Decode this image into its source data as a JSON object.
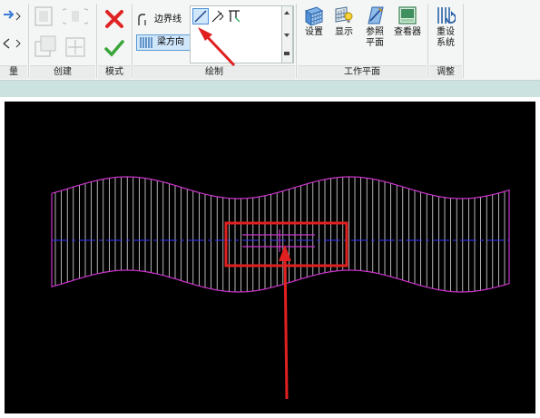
{
  "ribbon": {
    "panels": [
      {
        "label": "量"
      },
      {
        "label": "创建"
      },
      {
        "label": "模式"
      },
      {
        "label": "绘制"
      },
      {
        "label": "工作平面"
      },
      {
        "label": "调整"
      }
    ],
    "draw": {
      "boundary_line": "边界线",
      "span_direction": "梁方向"
    },
    "workplane": {
      "set": "设置",
      "show": "显示",
      "ref_plane_l1": "参照",
      "ref_plane_l2": "平面",
      "viewer": "查看器"
    },
    "adjust": {
      "reset_l1": "重设",
      "reset_l2": "系统"
    }
  },
  "colors": {
    "canvas": "#000000",
    "boundary": "#cc33cc",
    "hatch": "#ffffff",
    "center_line": "#3333ff",
    "highlight": "#e02020",
    "strip": "#cbe2e0"
  },
  "icons": [
    "cancel-x-icon",
    "finish-check-icon",
    "line-draw-icon",
    "pick-lines-icon",
    "pick-supports-icon",
    "workplane-set-icon",
    "workplane-show-icon",
    "reference-plane-icon",
    "viewer-icon",
    "reset-system-icon"
  ]
}
